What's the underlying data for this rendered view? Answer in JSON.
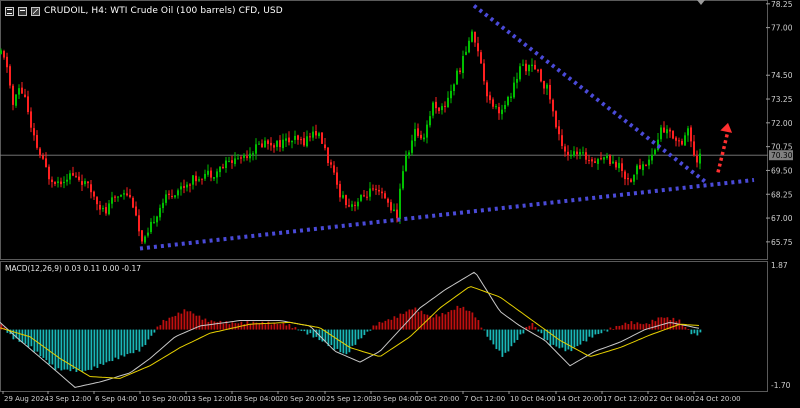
{
  "window": {
    "title": "CRUDOIL, H4:  WTI Crude Oil (100 barrels) CFD, USD",
    "icons": [
      "chart-window-icon",
      "minimize-icon",
      "maximize-icon"
    ]
  },
  "indicator": {
    "label": "MACD(12,26,9) 0.03 0.11 0.00 -0.17"
  },
  "colors": {
    "background": "#000000",
    "bull": "#00c000",
    "bear": "#ff2020",
    "trendline": "#4a4ad8",
    "projection_arrow": "#ff3030",
    "macd_positive": "#c01010",
    "macd_negative": "#1ab8b8",
    "signal_line": "#e6d000",
    "macd_line": "#c8c8c8",
    "axis_text": "#cfcfcf",
    "current_price_line": "#808080",
    "current_price_box": "#808080"
  },
  "chart_data": [
    {
      "type": "candlestick",
      "symbol": "CRUDOIL",
      "timeframe": "H4",
      "title": "CRUDOIL, H4:  WTI Crude Oil (100 barrels) CFD, USD",
      "y_ticks": [
        "78.25",
        "77.00",
        "74.50",
        "73.25",
        "72.00",
        "70.75",
        "69.50",
        "68.25",
        "67.00",
        "65.75"
      ],
      "y_tick_values": [
        78.25,
        77.0,
        74.5,
        73.25,
        72.0,
        70.75,
        69.5,
        68.25,
        67.0,
        65.75
      ],
      "ylim": [
        64.85,
        78.45
      ],
      "current_price": "70.30",
      "current_price_value": 70.3,
      "x_ticks": [
        "29 Aug 2024",
        "3 Sep 12:00",
        "6 Sep 04:00",
        "10 Sep 20:00",
        "13 Sep 12:00",
        "18 Sep 04:00",
        "20 Sep 20:00",
        "25 Sep 12:00",
        "30 Sep 04:00",
        "2 Oct 20:00",
        "7 Oct 12:00",
        "10 Oct 04:00",
        "14 Oct 20:00",
        "17 Oct 12:00",
        "22 Oct 04:00",
        "24 Oct 20:00"
      ],
      "close_path": [
        {
          "t": 0,
          "p": 75.6
        },
        {
          "t": 6,
          "p": 75.0
        },
        {
          "t": 12,
          "p": 72.9
        },
        {
          "t": 18,
          "p": 73.8
        },
        {
          "t": 24,
          "p": 73.4
        },
        {
          "t": 30,
          "p": 71.6
        },
        {
          "t": 38,
          "p": 70.4
        },
        {
          "t": 48,
          "p": 69.2
        },
        {
          "t": 58,
          "p": 68.9
        },
        {
          "t": 68,
          "p": 69.3
        },
        {
          "t": 80,
          "p": 69.0
        },
        {
          "t": 92,
          "p": 68.3
        },
        {
          "t": 104,
          "p": 67.2
        },
        {
          "t": 112,
          "p": 68.0
        },
        {
          "t": 124,
          "p": 68.5
        },
        {
          "t": 134,
          "p": 67.6
        },
        {
          "t": 140,
          "p": 65.6
        },
        {
          "t": 146,
          "p": 65.9
        },
        {
          "t": 152,
          "p": 66.9
        },
        {
          "t": 162,
          "p": 67.9
        },
        {
          "t": 174,
          "p": 68.4
        },
        {
          "t": 188,
          "p": 68.9
        },
        {
          "t": 202,
          "p": 69.3
        },
        {
          "t": 214,
          "p": 69.4
        },
        {
          "t": 226,
          "p": 69.9
        },
        {
          "t": 240,
          "p": 70.2
        },
        {
          "t": 252,
          "p": 70.6
        },
        {
          "t": 264,
          "p": 71.0
        },
        {
          "t": 276,
          "p": 70.9
        },
        {
          "t": 290,
          "p": 71.1
        },
        {
          "t": 302,
          "p": 71.0
        },
        {
          "t": 314,
          "p": 71.6
        },
        {
          "t": 322,
          "p": 70.9
        },
        {
          "t": 330,
          "p": 69.6
        },
        {
          "t": 338,
          "p": 68.4
        },
        {
          "t": 348,
          "p": 67.7
        },
        {
          "t": 358,
          "p": 67.9
        },
        {
          "t": 368,
          "p": 68.4
        },
        {
          "t": 380,
          "p": 68.2
        },
        {
          "t": 390,
          "p": 67.6
        },
        {
          "t": 396,
          "p": 66.9
        },
        {
          "t": 400,
          "p": 69.2
        },
        {
          "t": 406,
          "p": 70.3
        },
        {
          "t": 414,
          "p": 71.5
        },
        {
          "t": 422,
          "p": 71.2
        },
        {
          "t": 432,
          "p": 73.0
        },
        {
          "t": 442,
          "p": 72.7
        },
        {
          "t": 452,
          "p": 74.0
        },
        {
          "t": 462,
          "p": 75.3
        },
        {
          "t": 470,
          "p": 76.7
        },
        {
          "t": 476,
          "p": 76.2
        },
        {
          "t": 480,
          "p": 75.0
        },
        {
          "t": 486,
          "p": 73.6
        },
        {
          "t": 494,
          "p": 72.8
        },
        {
          "t": 502,
          "p": 72.6
        },
        {
          "t": 510,
          "p": 73.5
        },
        {
          "t": 520,
          "p": 75.0
        },
        {
          "t": 530,
          "p": 74.9
        },
        {
          "t": 538,
          "p": 74.5
        },
        {
          "t": 548,
          "p": 73.6
        },
        {
          "t": 556,
          "p": 71.5
        },
        {
          "t": 566,
          "p": 70.4
        },
        {
          "t": 578,
          "p": 70.3
        },
        {
          "t": 590,
          "p": 70.1
        },
        {
          "t": 602,
          "p": 70.2
        },
        {
          "t": 612,
          "p": 70.0
        },
        {
          "t": 620,
          "p": 69.6
        },
        {
          "t": 628,
          "p": 68.9
        },
        {
          "t": 636,
          "p": 69.6
        },
        {
          "t": 646,
          "p": 69.9
        },
        {
          "t": 654,
          "p": 70.6
        },
        {
          "t": 660,
          "p": 71.7
        },
        {
          "t": 670,
          "p": 71.4
        },
        {
          "t": 680,
          "p": 71.0
        },
        {
          "t": 688,
          "p": 71.8
        },
        {
          "t": 694,
          "p": 69.7
        },
        {
          "t": 700,
          "p": 70.3
        }
      ],
      "annotations": [
        {
          "kind": "dotted-trendline",
          "name": "descending-resistance-line",
          "from": {
            "t": 474,
            "p": 78.15
          },
          "to": {
            "t": 708,
            "p": 68.8
          }
        },
        {
          "kind": "dotted-trendline",
          "name": "ascending-support-line",
          "from": {
            "t": 140,
            "p": 65.4
          },
          "to": {
            "t": 754,
            "p": 69.0
          }
        },
        {
          "kind": "dotted-arrow",
          "name": "bullish-projection-arrow",
          "from": {
            "t": 718,
            "p": 69.4
          },
          "to": {
            "t": 728,
            "p": 72.0
          }
        }
      ]
    },
    {
      "type": "bar+line",
      "indicator": "MACD(12,26,9)",
      "y_ticks": [
        "1.87",
        "-1.70"
      ],
      "ylim": [
        -1.7,
        1.87
      ],
      "histogram_path": [
        {
          "t": 0,
          "v": 0.15
        },
        {
          "t": 10,
          "v": -0.2
        },
        {
          "t": 30,
          "v": -0.5
        },
        {
          "t": 55,
          "v": -1.1
        },
        {
          "t": 85,
          "v": -1.15
        },
        {
          "t": 115,
          "v": -0.8
        },
        {
          "t": 140,
          "v": -0.55
        },
        {
          "t": 160,
          "v": 0.2
        },
        {
          "t": 185,
          "v": 0.55
        },
        {
          "t": 205,
          "v": 0.25
        },
        {
          "t": 230,
          "v": 0.18
        },
        {
          "t": 255,
          "v": 0.2
        },
        {
          "t": 285,
          "v": 0.15
        },
        {
          "t": 310,
          "v": -0.15
        },
        {
          "t": 335,
          "v": -0.55
        },
        {
          "t": 345,
          "v": -0.7
        },
        {
          "t": 355,
          "v": -0.35
        },
        {
          "t": 375,
          "v": 0.15
        },
        {
          "t": 395,
          "v": 0.35
        },
        {
          "t": 412,
          "v": 0.6
        },
        {
          "t": 430,
          "v": 0.35
        },
        {
          "t": 445,
          "v": 0.45
        },
        {
          "t": 458,
          "v": 0.65
        },
        {
          "t": 472,
          "v": 0.45
        },
        {
          "t": 490,
          "v": -0.35
        },
        {
          "t": 502,
          "v": -0.75
        },
        {
          "t": 515,
          "v": -0.3
        },
        {
          "t": 530,
          "v": 0.2
        },
        {
          "t": 548,
          "v": -0.4
        },
        {
          "t": 568,
          "v": -0.6
        },
        {
          "t": 590,
          "v": -0.2
        },
        {
          "t": 612,
          "v": 0.05
        },
        {
          "t": 628,
          "v": 0.2
        },
        {
          "t": 645,
          "v": 0.15
        },
        {
          "t": 660,
          "v": 0.35
        },
        {
          "t": 678,
          "v": 0.25
        },
        {
          "t": 692,
          "v": -0.15
        },
        {
          "t": 700,
          "v": -0.1
        }
      ],
      "macd_path": [
        {
          "t": 0,
          "v": 0.2
        },
        {
          "t": 20,
          "v": -0.3
        },
        {
          "t": 50,
          "v": -1.0
        },
        {
          "t": 75,
          "v": -1.6
        },
        {
          "t": 100,
          "v": -1.45
        },
        {
          "t": 130,
          "v": -1.2
        },
        {
          "t": 150,
          "v": -0.8
        },
        {
          "t": 175,
          "v": -0.2
        },
        {
          "t": 200,
          "v": 0.1
        },
        {
          "t": 240,
          "v": 0.25
        },
        {
          "t": 280,
          "v": 0.25
        },
        {
          "t": 310,
          "v": 0.1
        },
        {
          "t": 335,
          "v": -0.6
        },
        {
          "t": 360,
          "v": -0.9
        },
        {
          "t": 380,
          "v": -0.6
        },
        {
          "t": 400,
          "v": 0.0
        },
        {
          "t": 420,
          "v": 0.6
        },
        {
          "t": 445,
          "v": 1.1
        },
        {
          "t": 475,
          "v": 1.6
        },
        {
          "t": 500,
          "v": 0.5
        },
        {
          "t": 520,
          "v": 0.1
        },
        {
          "t": 545,
          "v": -0.3
        },
        {
          "t": 570,
          "v": -1.0
        },
        {
          "t": 595,
          "v": -0.6
        },
        {
          "t": 620,
          "v": -0.35
        },
        {
          "t": 645,
          "v": 0.0
        },
        {
          "t": 670,
          "v": 0.2
        },
        {
          "t": 700,
          "v": 0.03
        }
      ],
      "signal_path": [
        {
          "t": 0,
          "v": 0.05
        },
        {
          "t": 30,
          "v": -0.2
        },
        {
          "t": 60,
          "v": -0.8
        },
        {
          "t": 90,
          "v": -1.3
        },
        {
          "t": 120,
          "v": -1.35
        },
        {
          "t": 150,
          "v": -1.0
        },
        {
          "t": 180,
          "v": -0.5
        },
        {
          "t": 210,
          "v": -0.1
        },
        {
          "t": 250,
          "v": 0.15
        },
        {
          "t": 290,
          "v": 0.2
        },
        {
          "t": 320,
          "v": 0.05
        },
        {
          "t": 350,
          "v": -0.5
        },
        {
          "t": 380,
          "v": -0.75
        },
        {
          "t": 410,
          "v": -0.2
        },
        {
          "t": 440,
          "v": 0.6
        },
        {
          "t": 470,
          "v": 1.2
        },
        {
          "t": 500,
          "v": 0.9
        },
        {
          "t": 530,
          "v": 0.3
        },
        {
          "t": 560,
          "v": -0.3
        },
        {
          "t": 590,
          "v": -0.75
        },
        {
          "t": 620,
          "v": -0.5
        },
        {
          "t": 650,
          "v": -0.15
        },
        {
          "t": 680,
          "v": 0.15
        },
        {
          "t": 700,
          "v": 0.11
        }
      ]
    }
  ]
}
